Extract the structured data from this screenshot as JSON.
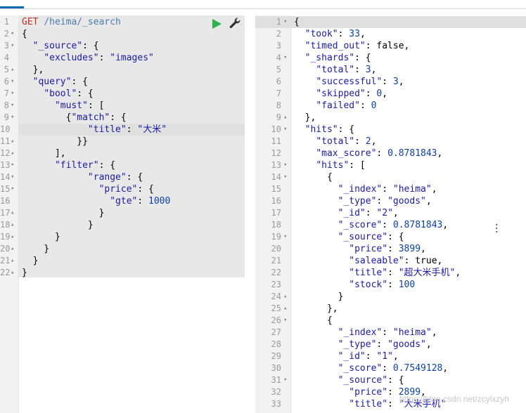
{
  "left_editor": {
    "request_method": "GET",
    "request_path": "/heima/_search",
    "run_icon": "play-icon",
    "tools_icon": "wrench-icon",
    "active_line": 10,
    "lines": [
      {
        "n": "1",
        "fold": "",
        "text": "GET /heima/_search"
      },
      {
        "n": "2",
        "fold": "▾",
        "text": "{"
      },
      {
        "n": "3",
        "fold": "▾",
        "text": "  \"_source\": {"
      },
      {
        "n": "4",
        "fold": "",
        "text": "    \"excludes\": \"images\""
      },
      {
        "n": "5",
        "fold": "▴",
        "text": "  },"
      },
      {
        "n": "6",
        "fold": "▾",
        "text": "  \"query\": {"
      },
      {
        "n": "7",
        "fold": "▾",
        "text": "    \"bool\": {"
      },
      {
        "n": "8",
        "fold": "▾",
        "text": "      \"must\": ["
      },
      {
        "n": "9",
        "fold": "▾",
        "text": "        {\"match\": {"
      },
      {
        "n": "10",
        "fold": "",
        "text": "            \"title\": \"大米\""
      },
      {
        "n": "11",
        "fold": "▴",
        "text": "          }}"
      },
      {
        "n": "12",
        "fold": "▴",
        "text": "      ],"
      },
      {
        "n": "13",
        "fold": "▾",
        "text": "      \"filter\": {"
      },
      {
        "n": "14",
        "fold": "▾",
        "text": "            \"range\": {"
      },
      {
        "n": "15",
        "fold": "▾",
        "text": "              \"price\": {"
      },
      {
        "n": "16",
        "fold": "",
        "text": "                \"gte\": 1000"
      },
      {
        "n": "17",
        "fold": "▴",
        "text": "              }"
      },
      {
        "n": "18",
        "fold": "▴",
        "text": "            }"
      },
      {
        "n": "19",
        "fold": "▴",
        "text": "      }"
      },
      {
        "n": "20",
        "fold": "▴",
        "text": "    }"
      },
      {
        "n": "21",
        "fold": "▴",
        "text": "  }"
      },
      {
        "n": "22",
        "fold": "▴",
        "text": "}"
      }
    ]
  },
  "right_editor": {
    "active_line": 1,
    "lines": [
      {
        "n": "1",
        "fold": "▾",
        "text": "{"
      },
      {
        "n": "2",
        "fold": "",
        "text": "  \"took\": 33,"
      },
      {
        "n": "3",
        "fold": "",
        "text": "  \"timed_out\": false,"
      },
      {
        "n": "4",
        "fold": "▾",
        "text": "  \"_shards\": {"
      },
      {
        "n": "5",
        "fold": "",
        "text": "    \"total\": 3,"
      },
      {
        "n": "6",
        "fold": "",
        "text": "    \"successful\": 3,"
      },
      {
        "n": "7",
        "fold": "",
        "text": "    \"skipped\": 0,"
      },
      {
        "n": "8",
        "fold": "",
        "text": "    \"failed\": 0"
      },
      {
        "n": "9",
        "fold": "▴",
        "text": "  },"
      },
      {
        "n": "10",
        "fold": "▾",
        "text": "  \"hits\": {"
      },
      {
        "n": "11",
        "fold": "",
        "text": "    \"total\": 2,"
      },
      {
        "n": "12",
        "fold": "",
        "text": "    \"max_score\": 0.8781843,"
      },
      {
        "n": "13",
        "fold": "▾",
        "text": "    \"hits\": ["
      },
      {
        "n": "14",
        "fold": "▾",
        "text": "      {"
      },
      {
        "n": "15",
        "fold": "",
        "text": "        \"_index\": \"heima\","
      },
      {
        "n": "16",
        "fold": "",
        "text": "        \"_type\": \"goods\","
      },
      {
        "n": "17",
        "fold": "",
        "text": "        \"_id\": \"2\","
      },
      {
        "n": "18",
        "fold": "",
        "text": "        \"_score\": 0.8781843,"
      },
      {
        "n": "19",
        "fold": "▾",
        "text": "        \"_source\": {"
      },
      {
        "n": "20",
        "fold": "",
        "text": "          \"price\": 3899,"
      },
      {
        "n": "21",
        "fold": "",
        "text": "          \"saleable\": true,"
      },
      {
        "n": "22",
        "fold": "",
        "text": "          \"title\": \"超大米手机\","
      },
      {
        "n": "23",
        "fold": "",
        "text": "          \"stock\": 100"
      },
      {
        "n": "24",
        "fold": "▴",
        "text": "        }"
      },
      {
        "n": "25",
        "fold": "▴",
        "text": "      },"
      },
      {
        "n": "26",
        "fold": "▾",
        "text": "      {"
      },
      {
        "n": "27",
        "fold": "",
        "text": "        \"_index\": \"heima\","
      },
      {
        "n": "28",
        "fold": "",
        "text": "        \"_type\": \"goods\","
      },
      {
        "n": "29",
        "fold": "",
        "text": "        \"_id\": \"1\","
      },
      {
        "n": "30",
        "fold": "",
        "text": "        \"_score\": 0.7549128,"
      },
      {
        "n": "31",
        "fold": "▾",
        "text": "        \"_source\": {"
      },
      {
        "n": "32",
        "fold": "",
        "text": "          \"price\": 2899,"
      },
      {
        "n": "33",
        "fold": "",
        "text": "          \"title\": \"大米手机\""
      }
    ]
  },
  "divider_icon": "vertical-dots-icon",
  "watermark": "https://blog.csdn.net/zcylxzyh",
  "colors": {
    "gutter": "#f2f2f2",
    "left_background": "#e8e8e8",
    "active_line": "#e0e0e0",
    "string": "#1a1aa6",
    "number": "#0b3fa8",
    "method": "#c03020",
    "path": "#4a7bb0",
    "run": "#2bb24c",
    "tab_accent": "#006bb4"
  }
}
